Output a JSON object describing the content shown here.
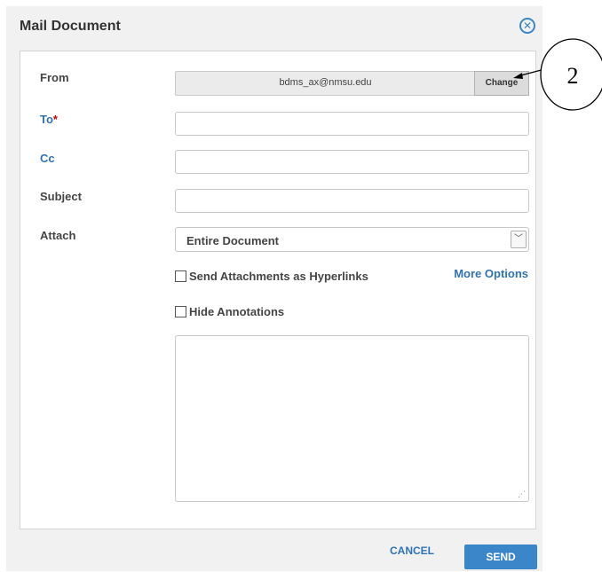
{
  "dialog": {
    "title": "Mail Document",
    "close_icon": "close-circle-icon"
  },
  "form": {
    "from_label": "From",
    "from_value": "bdms_ax@nmsu.edu",
    "change_label": "Change",
    "to_label": "To",
    "to_required_marker": "*",
    "to_value": "",
    "cc_label": "Cc",
    "cc_value": "",
    "subject_label": "Subject",
    "subject_value": "",
    "attach_label": "Attach",
    "attach_selected": "Entire Document",
    "send_as_hyperlinks_label": "Send Attachments as Hyperlinks",
    "send_as_hyperlinks_checked": false,
    "more_options_label": "More Options",
    "hide_annotations_label": "Hide Annotations",
    "hide_annotations_checked": false,
    "message_value": ""
  },
  "footer": {
    "cancel_label": "CANCEL",
    "send_label": "SEND"
  },
  "annotation": {
    "callout_number": "2"
  },
  "colors": {
    "accent": "#3b86c8",
    "link": "#2f73b6",
    "required": "#d00000"
  }
}
